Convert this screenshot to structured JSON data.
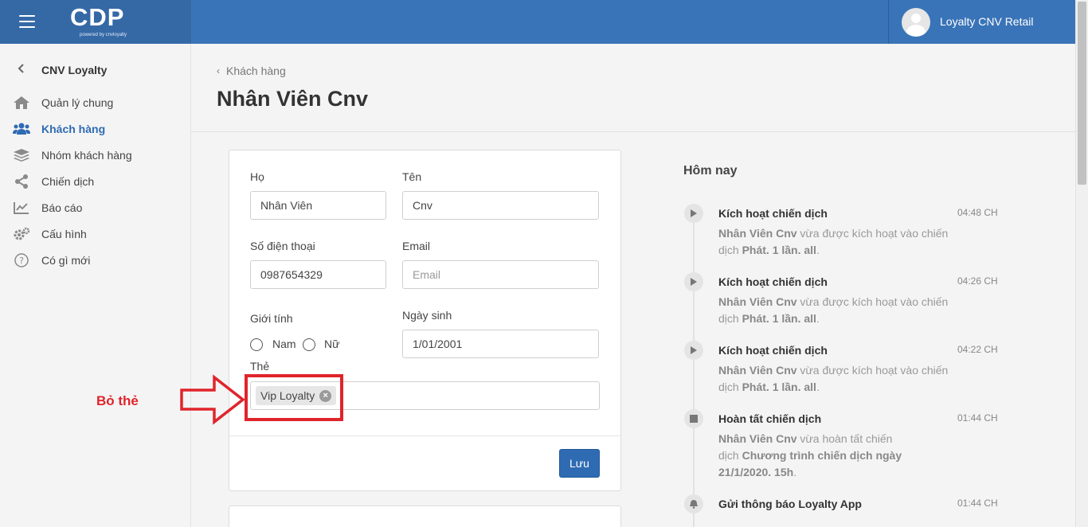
{
  "header": {
    "logo": "CDP",
    "logo_sub": "powered by cnvloyalty",
    "user_name": "Loyalty CNV Retail"
  },
  "sidebar": {
    "title": "CNV Loyalty",
    "items": [
      {
        "label": "Quản lý chung",
        "icon": "home-icon"
      },
      {
        "label": "Khách hàng",
        "icon": "users-icon",
        "active": true
      },
      {
        "label": "Nhóm khách hàng",
        "icon": "layers-icon"
      },
      {
        "label": "Chiến dịch",
        "icon": "share-icon"
      },
      {
        "label": "Báo cáo",
        "icon": "chart-icon"
      },
      {
        "label": "Cấu hình",
        "icon": "gears-icon"
      },
      {
        "label": "Có gì mới",
        "icon": "help-icon"
      }
    ]
  },
  "page": {
    "breadcrumb": "Khách hàng",
    "title": "Nhân Viên Cnv"
  },
  "form": {
    "last_name_label": "Họ",
    "last_name_value": "Nhân Viên",
    "first_name_label": "Tên",
    "first_name_value": "Cnv",
    "phone_label": "Số điện thoại",
    "phone_value": "0987654329",
    "email_label": "Email",
    "email_placeholder": "Email",
    "gender_label": "Giới tính",
    "gender_male": "Nam",
    "gender_female": "Nữ",
    "birthday_label": "Ngày sinh",
    "birthday_value": "1/01/2001",
    "card_label": "Thẻ",
    "card_tag": "Vip Loyalty",
    "save_label": "Lưu"
  },
  "annotation": {
    "text": "Bỏ thẻ"
  },
  "timeline": {
    "title": "Hôm nay",
    "events": [
      {
        "title": "Kích hoạt chiến dịch",
        "time": "04:48 CH",
        "who": "Nhân Viên Cnv",
        "text1": " vừa được kích hoạt vào chiến",
        "text2": "dịch ",
        "campaign": "Phát. 1 lần. all",
        "end": ".",
        "icon": "play-icon"
      },
      {
        "title": "Kích hoạt chiến dịch",
        "time": "04:26 CH",
        "who": "Nhân Viên Cnv",
        "text1": " vừa được kích hoạt vào chiến",
        "text2": "dịch ",
        "campaign": "Phát. 1 lần. all",
        "end": ".",
        "icon": "play-icon"
      },
      {
        "title": "Kích hoạt chiến dịch",
        "time": "04:22 CH",
        "who": "Nhân Viên Cnv",
        "text1": " vừa được kích hoạt vào chiến",
        "text2": "dịch ",
        "campaign": "Phát. 1 lần. all",
        "end": ".",
        "icon": "play-icon"
      },
      {
        "title": "Hoàn tất chiến dịch",
        "time": "01:44 CH",
        "who": "Nhân Viên Cnv",
        "text1": " vừa hoàn tất chiến",
        "text2": "dịch ",
        "campaign": "Chương trình chiến dịch ngày 21/1/2020. 15h",
        "end": ".",
        "icon": "stop-icon"
      },
      {
        "title": "Gửi thông báo Loyalty App",
        "time": "01:44 CH",
        "icon": "bell-icon"
      }
    ]
  }
}
